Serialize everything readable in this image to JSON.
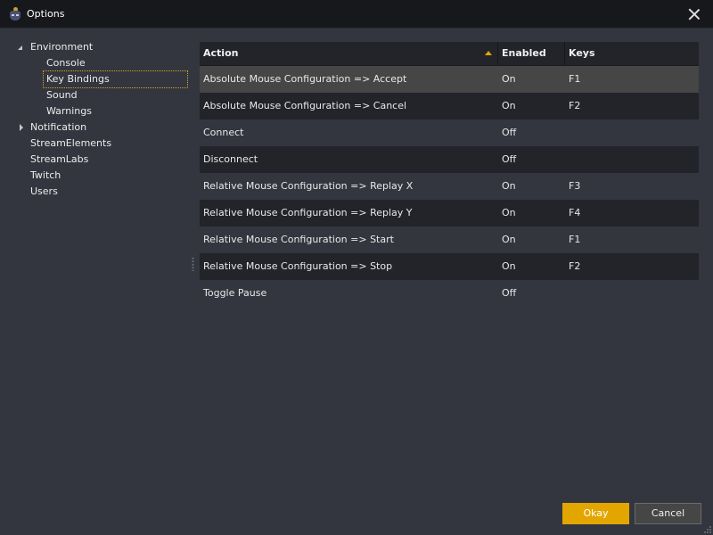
{
  "window": {
    "title": "Options",
    "icon": "app-mascot-icon",
    "close_icon": "close-icon"
  },
  "tree": {
    "items": [
      {
        "label": "Environment",
        "level": 0,
        "expander": "expanded"
      },
      {
        "label": "Console",
        "level": 1
      },
      {
        "label": "Key Bindings",
        "level": 1,
        "selected": true
      },
      {
        "label": "Sound",
        "level": 1
      },
      {
        "label": "Warnings",
        "level": 1
      },
      {
        "label": "Notification",
        "level": 0,
        "expander": "collapsed"
      },
      {
        "label": "StreamElements",
        "level": 0
      },
      {
        "label": "StreamLabs",
        "level": 0
      },
      {
        "label": "Twitch",
        "level": 0
      },
      {
        "label": "Users",
        "level": 0
      }
    ]
  },
  "grid": {
    "columns": {
      "action": "Action",
      "enabled": "Enabled",
      "keys": "Keys"
    },
    "sort": {
      "column": "Action",
      "direction": "ascending"
    },
    "rows": [
      {
        "action": "Absolute Mouse Configuration => Accept",
        "enabled": "On",
        "keys": "F1",
        "selected": true
      },
      {
        "action": "Absolute Mouse Configuration => Cancel",
        "enabled": "On",
        "keys": "F2"
      },
      {
        "action": "Connect",
        "enabled": "Off",
        "keys": ""
      },
      {
        "action": "Disconnect",
        "enabled": "Off",
        "keys": ""
      },
      {
        "action": "Relative Mouse Configuration => Replay X",
        "enabled": "On",
        "keys": "F3"
      },
      {
        "action": "Relative Mouse Configuration => Replay Y",
        "enabled": "On",
        "keys": "F4"
      },
      {
        "action": "Relative Mouse Configuration => Start",
        "enabled": "On",
        "keys": "F1"
      },
      {
        "action": "Relative Mouse Configuration => Stop",
        "enabled": "On",
        "keys": "F2"
      },
      {
        "action": "Toggle Pause",
        "enabled": "Off",
        "keys": ""
      }
    ]
  },
  "buttons": {
    "okay": "Okay",
    "cancel": "Cancel"
  },
  "colors": {
    "accent": "#e3a600",
    "background": "#33363f",
    "titlebar": "#17181c",
    "row_alt": "#23242a",
    "row_selected": "#464646"
  }
}
